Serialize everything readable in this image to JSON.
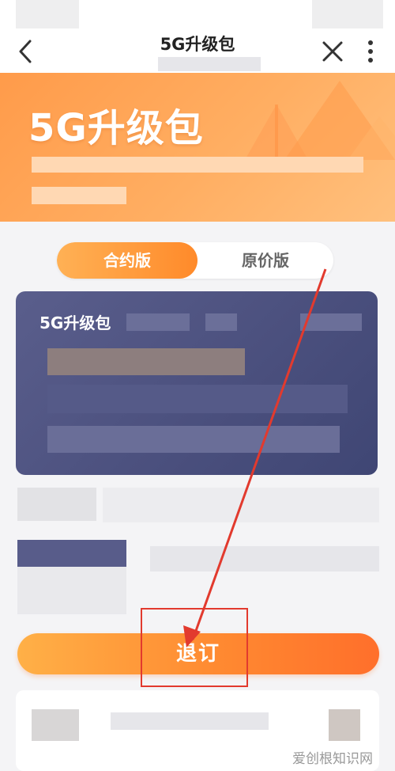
{
  "nav": {
    "title": "5G升级包",
    "back_icon": "chevron-left-icon",
    "close_icon": "close-icon",
    "more_icon": "more-vertical-icon"
  },
  "banner": {
    "title": "5G升级包"
  },
  "tabs": [
    {
      "label": "合约版",
      "active": true
    },
    {
      "label": "原价版",
      "active": false
    }
  ],
  "card": {
    "title": "5G升级包"
  },
  "cta": {
    "label": "退订"
  },
  "watermark": {
    "text": "爱创根知识网"
  },
  "colors": {
    "accent": "#ff8a2a",
    "banner": "#ffae62",
    "card": "#4a4f7d",
    "annotation": "#e23a2e"
  }
}
